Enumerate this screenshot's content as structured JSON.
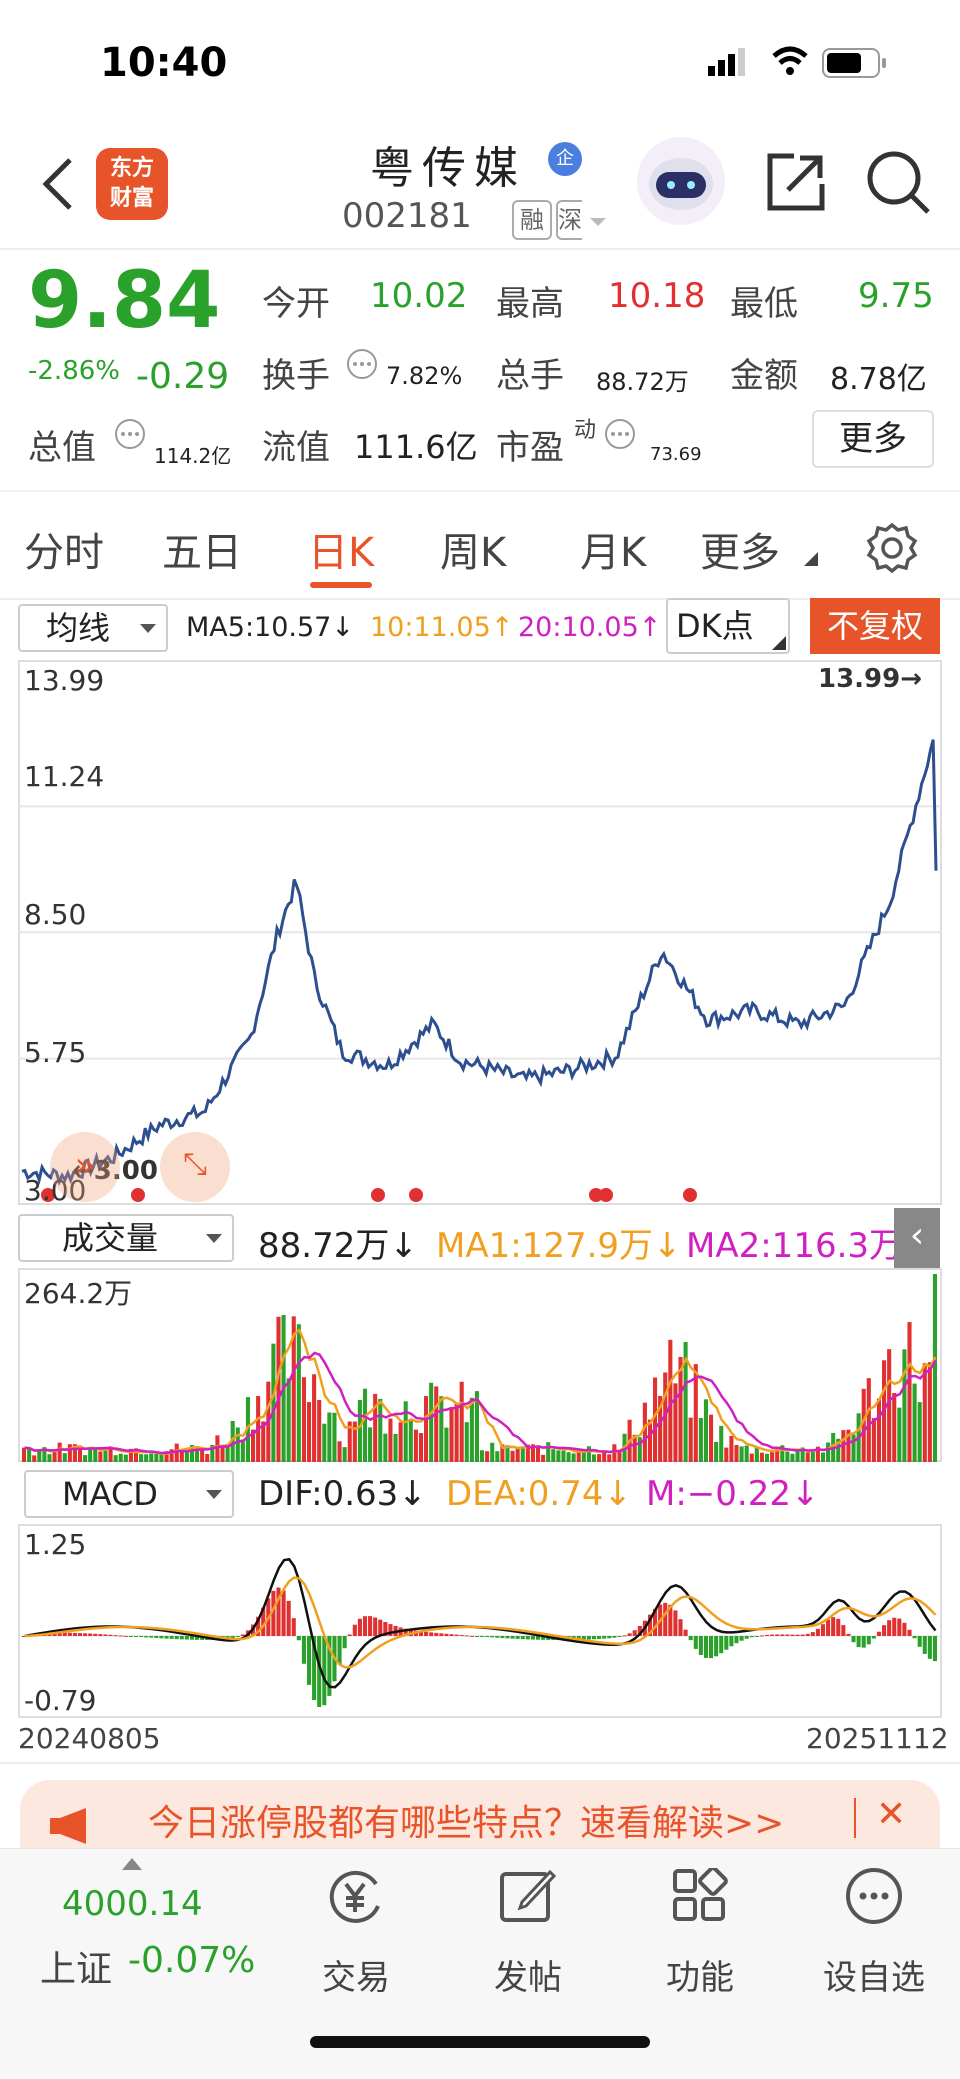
{
  "status_bar": {
    "time": "10:40"
  },
  "header": {
    "logo_text_line1": "东方",
    "logo_text_line2": "财富",
    "stock_name": "粤传媒",
    "name_badge": "企",
    "stock_code": "002181",
    "tag1": "融",
    "tag2": "深"
  },
  "quote": {
    "price": "9.84",
    "change_pct": "-2.86%",
    "change": "-0.29",
    "open_label": "今开",
    "open": "10.02",
    "high_label": "最高",
    "high": "10.18",
    "low_label": "最低",
    "low": "9.75",
    "turnover_label": "换手",
    "turnover": "7.82%",
    "volume_label": "总手",
    "volume": "88.72万",
    "amount_label": "金额",
    "amount": "8.78亿",
    "mcap_label": "总值",
    "mcap": "114.2亿",
    "float_label": "流值",
    "float_mcap": "111.6亿",
    "pe_label": "市盈",
    "pe_sup": "动",
    "pe": "73.69",
    "more_button": "更多"
  },
  "tabs": [
    {
      "label": "分时"
    },
    {
      "label": "五日"
    },
    {
      "label": "日K"
    },
    {
      "label": "周K"
    },
    {
      "label": "月K"
    },
    {
      "label": "更多"
    }
  ],
  "ma_bar": {
    "dropdown": "均线",
    "ma5": "MA5:10.57↓",
    "ma10": "10:11.05↑",
    "ma20": "20:10.05↑",
    "dk": "DK点",
    "fq_button": "不复权"
  },
  "volume_bar": {
    "dropdown": "成交量",
    "vol": "88.72万↓",
    "ma1": "MA1:127.9万↓",
    "ma2": "MA2:116.3万↓"
  },
  "macd_bar": {
    "dropdown": "MACD",
    "dif": "DIF:0.63↓",
    "dea": "DEA:0.74↓",
    "m": "M:−0.22↓"
  },
  "chart_data": [
    {
      "type": "line",
      "title": "",
      "y_ticks": [
        "13.99",
        "11.24",
        "8.50",
        "5.75",
        "3.00"
      ],
      "ylim": [
        3.0,
        13.99
      ],
      "max_label": "13.99→",
      "min_label": "←3.00",
      "x_start": "20240805",
      "x_end": "20251112",
      "x": [
        0,
        5,
        10,
        15,
        20,
        25,
        28,
        30,
        32,
        35,
        40,
        45,
        48,
        50,
        55,
        60,
        65,
        70,
        75,
        80,
        85,
        90,
        95,
        100
      ],
      "values": [
        3.3,
        3.2,
        3.6,
        4.3,
        4.6,
        6.2,
        8.5,
        9.6,
        7.5,
        5.9,
        5.6,
        6.5,
        5.7,
        5.6,
        5.3,
        5.5,
        5.8,
        8.1,
        6.6,
        6.8,
        6.5,
        6.9,
        9.2,
        12.9
      ],
      "last": 9.84
    },
    {
      "type": "bar",
      "title": "",
      "y_max_label": "264.2万",
      "ylim": [
        0,
        264.2
      ]
    },
    {
      "type": "bar",
      "title": "",
      "y_max_label": "1.25",
      "y_min_label": "-0.79",
      "ylim": [
        -0.79,
        1.25
      ]
    }
  ],
  "banner": {
    "text": "今日涨停股都有哪些特点？速看解读>>",
    "close": "✕"
  },
  "bottom_nav": {
    "index_value": "4000.14",
    "index_name": "上证",
    "index_change": "-0.07%",
    "items": [
      {
        "label": "交易"
      },
      {
        "label": "发帖"
      },
      {
        "label": "功能"
      },
      {
        "label": "设自选"
      }
    ]
  },
  "colors": {
    "up": "#e03030",
    "down": "#2aa12a",
    "line": "#2d4f8f",
    "ma1": "#f0a020",
    "ma2": "#d020c0",
    "accent": "#e8542a"
  }
}
